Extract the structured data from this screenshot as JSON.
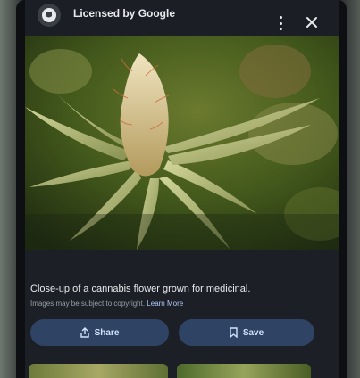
{
  "header": {
    "source_title": "Licensed by Google",
    "logo_icon": "source-logo-icon",
    "more_icon": "more-vert-icon",
    "close_icon": "close-icon"
  },
  "image": {
    "description_icon": "cannabis-plant-photo"
  },
  "caption": {
    "text": "Close-up of a cannabis flower grown for medicinal.",
    "notice": "Images may be subject to copyright.",
    "learn_more": "Learn More"
  },
  "actions": {
    "share_label": "Share",
    "share_icon": "share-icon",
    "save_label": "Save",
    "save_icon": "bookmark-icon"
  },
  "colors": {
    "screen_bg": "#1c1f26",
    "button_bg": "#2f4364",
    "button_text": "#d2e3fc",
    "link": "#aecbfa"
  }
}
